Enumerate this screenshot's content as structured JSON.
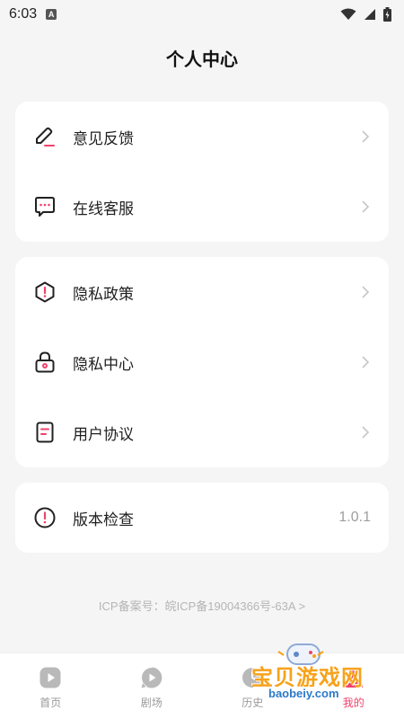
{
  "status_bar": {
    "time": "6:03",
    "notif": "A"
  },
  "page": {
    "title": "个人中心"
  },
  "groups": [
    {
      "items": [
        {
          "label": "意见反馈",
          "icon": "feedback-pen-icon"
        },
        {
          "label": "在线客服",
          "icon": "chat-bubble-icon"
        }
      ]
    },
    {
      "items": [
        {
          "label": "隐私政策",
          "icon": "privacy-shield-icon"
        },
        {
          "label": "隐私中心",
          "icon": "lock-icon"
        },
        {
          "label": "用户协议",
          "icon": "document-icon"
        }
      ]
    },
    {
      "items": [
        {
          "label": "版本检查",
          "icon": "info-circle-icon",
          "value": "1.0.1"
        }
      ]
    }
  ],
  "icp": "ICP备案号：皖ICP备19004366号-63A >",
  "tabs": [
    {
      "label": "首页",
      "icon": "home-play-icon",
      "active": false
    },
    {
      "label": "剧场",
      "icon": "theater-icon",
      "active": false
    },
    {
      "label": "历史",
      "icon": "history-icon",
      "active": false
    },
    {
      "label": "我的",
      "icon": "profile-icon",
      "active": true
    }
  ],
  "watermark": {
    "text": "宝贝游戏网",
    "url": "baobeiy.com"
  },
  "colors": {
    "accent": "#f0436b",
    "text": "#1f1f1f",
    "muted": "#9e9e9e",
    "background": "#f5f5f5"
  }
}
